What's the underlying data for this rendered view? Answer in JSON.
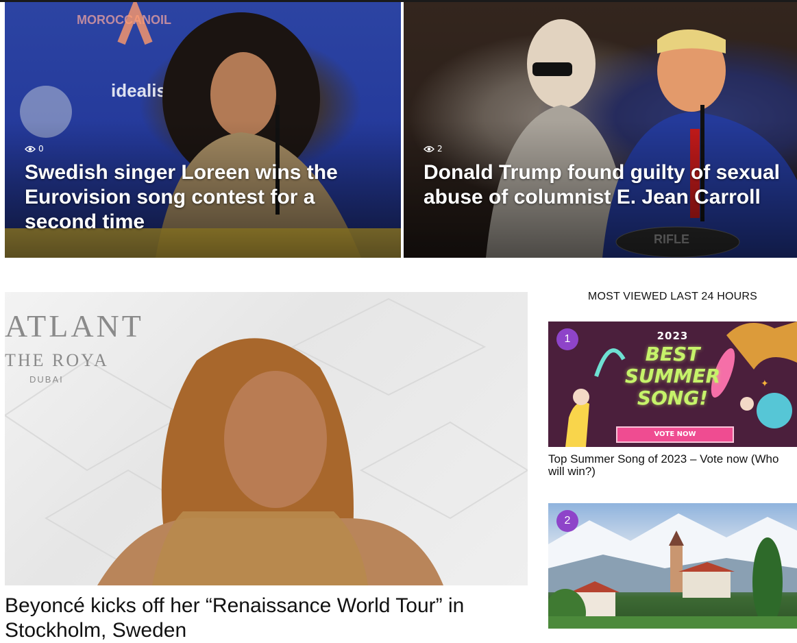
{
  "heroes": [
    {
      "views": "0",
      "title": "Swedish singer Loreen wins the Eurovision song contest for a second time",
      "image_label": "MOROCCANOIL"
    },
    {
      "views": "2",
      "title": "Donald Trump found guilty of sexual abuse of columnist E. Jean Carroll",
      "image_label": "RIFLE"
    }
  ],
  "main_article": {
    "title": "Beyoncé kicks off her “Renaissance World Tour” in Stockholm, Sweden",
    "image_labels": [
      "ATLANTIS",
      "THE ROYAL",
      "DUBAI"
    ]
  },
  "sidebar": {
    "heading": "MOST VIEWED LAST 24 HOURS",
    "items": [
      {
        "rank": "1",
        "title": "Top Summer Song of 2023 – Vote now (Who will win?)",
        "poster": {
          "year": "2023",
          "text": [
            "BEST",
            "SUMMER",
            "SONG!"
          ],
          "button": "VOTE NOW"
        }
      },
      {
        "rank": "2"
      }
    ]
  },
  "colors": {
    "badge": "#8e44c9",
    "hero_left_bg": "#2c44a3",
    "poster_bg": "#4b1f3c",
    "poster_text": "#c6f36a",
    "vote_button": "#ef4c91"
  },
  "icons": {
    "views": "eye-icon"
  }
}
